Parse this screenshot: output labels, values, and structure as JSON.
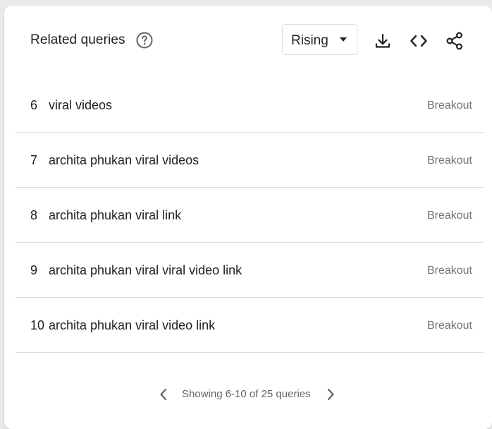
{
  "header": {
    "title": "Related queries",
    "help_icon": "help-circle-icon",
    "dropdown_value": "Rising",
    "actions": [
      "download-icon",
      "embed-code-icon",
      "share-icon"
    ]
  },
  "queries": [
    {
      "rank": "6",
      "text": "viral videos",
      "value": "Breakout"
    },
    {
      "rank": "7",
      "text": "archita phukan viral videos",
      "value": "Breakout"
    },
    {
      "rank": "8",
      "text": "archita phukan viral link",
      "value": "Breakout"
    },
    {
      "rank": "9",
      "text": "archita phukan viral viral video link",
      "value": "Breakout"
    },
    {
      "rank": "10",
      "text": "archita phukan viral video link",
      "value": "Breakout"
    }
  ],
  "pagination": {
    "text": "Showing 6-10 of 25 queries"
  },
  "colors": {
    "text": "#202124",
    "muted": "#70757a",
    "divider": "#dadce0"
  }
}
